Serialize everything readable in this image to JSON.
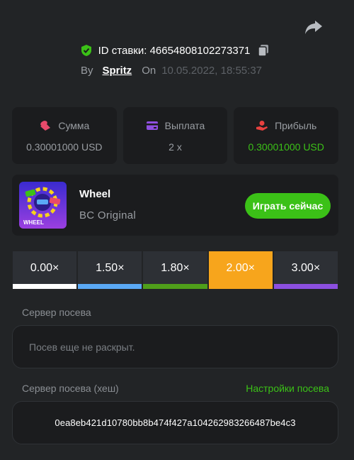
{
  "header": {
    "bet_id_label": "ID ставки: 4665480810227337​1",
    "by_label": "By",
    "username": "Spritz",
    "on_label": "On",
    "date": "10.05.2022, 18:55:37"
  },
  "stats": [
    {
      "label": "Сумма",
      "value": "0.30001000 USD",
      "icon": "coins-icon",
      "icon_color": "#e84a6b"
    },
    {
      "label": "Выплата",
      "value": "2 x",
      "icon": "card-icon",
      "icon_color": "#8f4fe0"
    },
    {
      "label": "Прибыль",
      "value": "0.30001000 USD",
      "icon": "hand-coin-icon",
      "icon_color": "#e8413f",
      "value_color": "#3bc117"
    }
  ],
  "game": {
    "name": "Wheel",
    "provider": "BC Original",
    "play_label": "Играть сейчас",
    "thumb_text": "WHEEL"
  },
  "multipliers": [
    {
      "label": "0.00×",
      "color": "#ffffff",
      "active": false
    },
    {
      "label": "1.50×",
      "color": "#5aa9f5",
      "active": false
    },
    {
      "label": "1.80×",
      "color": "#4f9f1a",
      "active": false
    },
    {
      "label": "2.00×",
      "color": "#f7a51c",
      "active": true
    },
    {
      "label": "3.00×",
      "color": "#8c4fe0",
      "active": false
    }
  ],
  "seed": {
    "server_label": "Сервер посева",
    "server_placeholder": "Посев еще не раскрыт.",
    "hash_label": "Сервер посева (хеш)",
    "settings_link": "Настройки посева",
    "hash_value": "0ea8eb421d10780bb8b474f427a104262983266487be4c3"
  },
  "colors": {
    "background": "#222426",
    "panel": "#1b1c1e",
    "accent_green": "#3bc117"
  }
}
